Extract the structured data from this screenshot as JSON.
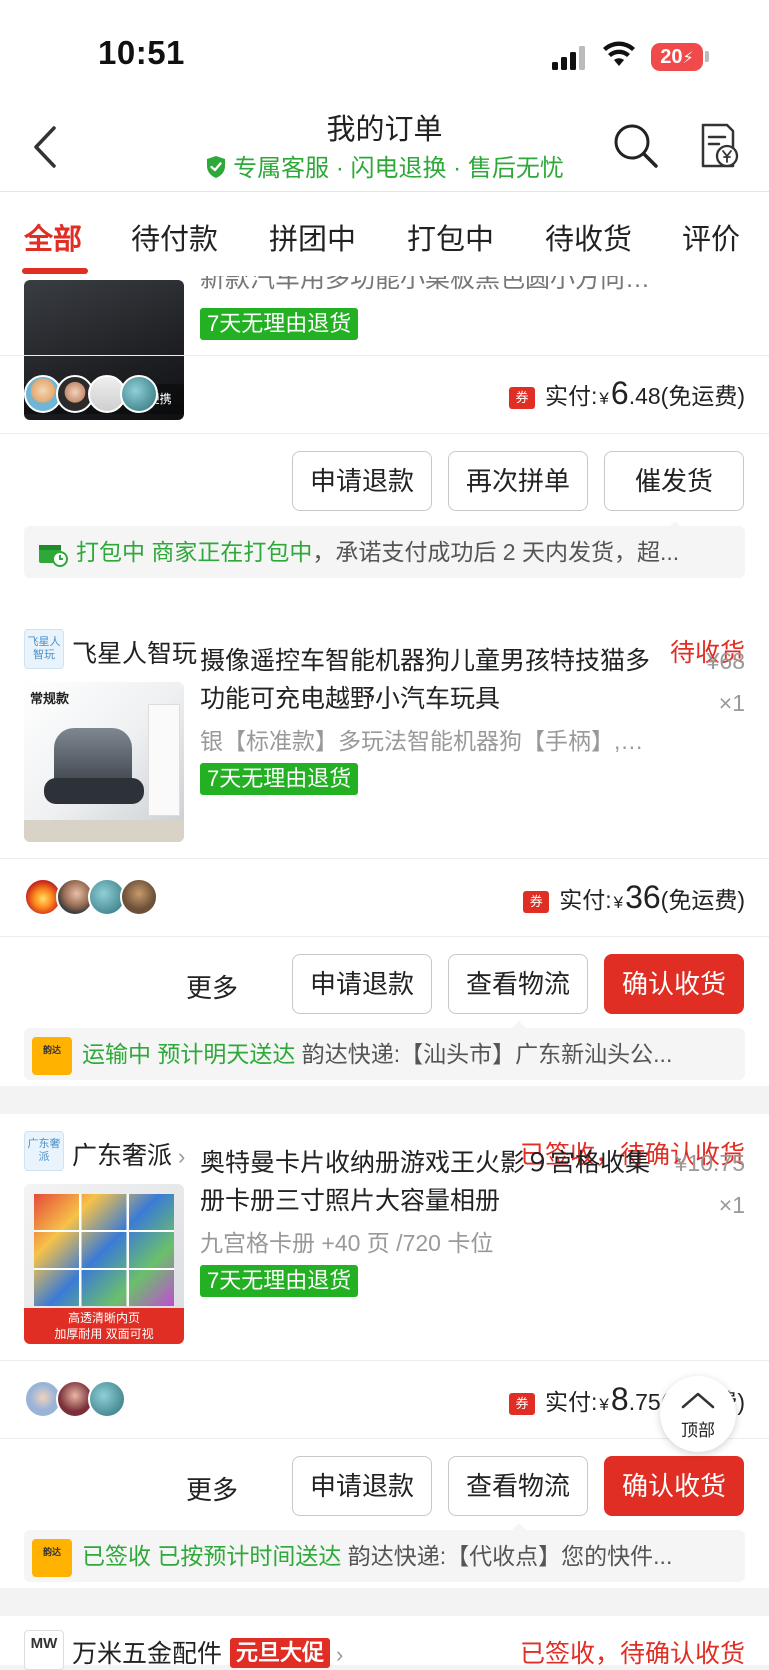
{
  "status_bar": {
    "time": "10:51",
    "battery": "20"
  },
  "header": {
    "title": "我的订单",
    "subtitle": "专属客服 · 闪电退换 · 售后无忧"
  },
  "tabs": [
    "全部",
    "待付款",
    "拼团中",
    "打包中",
    "待收货",
    "评价"
  ],
  "orders": [
    {
      "product_title": "新款汽车用多功能小桌板黑色圆小方向…",
      "thumb_caption": "无损安装 轻松拆卸更便携",
      "return_tag": "7天无理由退货",
      "paid_label": "实付:",
      "paid_yen": "¥",
      "paid_int": "6",
      "paid_dec": ".48",
      "shipping": "(免运费)",
      "buttons": [
        "申请退款",
        "再次拼单",
        "催发货"
      ],
      "info_status": "打包中 商家正在打包中",
      "info_detail": "，承诺支付成功后 2 天内发货，超..."
    },
    {
      "shop_logo": "飞星人智玩",
      "shop_name": "飞星人智玩",
      "status": "待收货",
      "product_title": "摄像遥控车智能机器狗儿童男孩特技猫多功能可充电越野小汽车玩具",
      "price": "¥68",
      "qty": "×1",
      "spec": "银【标准款】多玩法智能机器狗【手柄】,…",
      "thumb_caption": "常规款",
      "return_tag": "7天无理由退货",
      "paid_label": "实付:",
      "paid_yen": "¥",
      "paid_int": "36",
      "paid_dec": "",
      "shipping": "(免运费)",
      "more": "更多",
      "buttons": [
        "申请退款",
        "查看物流",
        "确认收货"
      ],
      "courier_logo": "韵达",
      "info_status": "运输中 预计明天送达",
      "info_detail": " 韵达快递:【汕头市】广东新汕头公..."
    },
    {
      "shop_logo": "广东奢派",
      "shop_name": "广东奢派",
      "status": "已签收，待确认收货",
      "product_title": "奥特曼卡片收纳册游戏王火影９宫格收集册卡册三寸照片大容量相册",
      "price": "¥10.75",
      "qty": "×1",
      "spec": "九宫格卡册 +40 页 /720 卡位",
      "thumb_caption": "高透清晰内页",
      "thumb_caption2": "加厚耐用 双面可视",
      "return_tag": "7天无理由退货",
      "paid_label": "实付:",
      "paid_yen": "¥",
      "paid_int": "8",
      "paid_dec": ".75",
      "shipping": "(免运费)",
      "more": "更多",
      "buttons": [
        "申请退款",
        "查看物流",
        "确认收货"
      ],
      "courier_logo": "韵达",
      "info_status": "已签收 已按预计时间送达",
      "info_detail": " 韵达快递:【代收点】您的快件..."
    },
    {
      "shop_logo": "MW",
      "shop_name": "万米五金配件",
      "promo": "元旦大促",
      "status": "已签收，待确认收货"
    }
  ],
  "back_to_top": "顶部",
  "colors": {
    "accent": "#e02e24",
    "green": "#2fa83a",
    "tag_green": "#23b023"
  }
}
